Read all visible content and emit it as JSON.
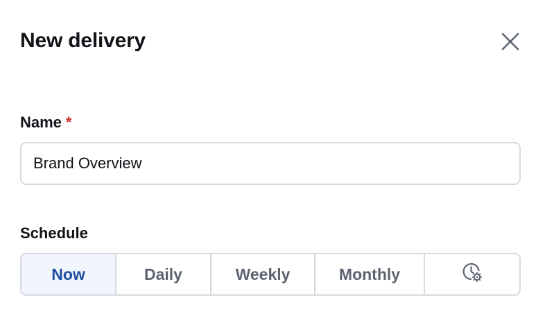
{
  "dialog": {
    "title": "New delivery",
    "close_icon": "close-icon"
  },
  "name_field": {
    "label": "Name",
    "required_marker": "*",
    "value": "Brand Overview"
  },
  "schedule": {
    "label": "Schedule",
    "options": [
      {
        "label": "Now",
        "selected": true
      },
      {
        "label": "Daily",
        "selected": false
      },
      {
        "label": "Weekly",
        "selected": false
      },
      {
        "label": "Monthly",
        "selected": false
      },
      {
        "label": "",
        "icon": "clock-settings-icon",
        "selected": false
      }
    ]
  },
  "colors": {
    "accent": "#1f4ea3",
    "active_bg": "#f1f5fc",
    "required": "#d12f2f",
    "border": "#d6d9df"
  }
}
